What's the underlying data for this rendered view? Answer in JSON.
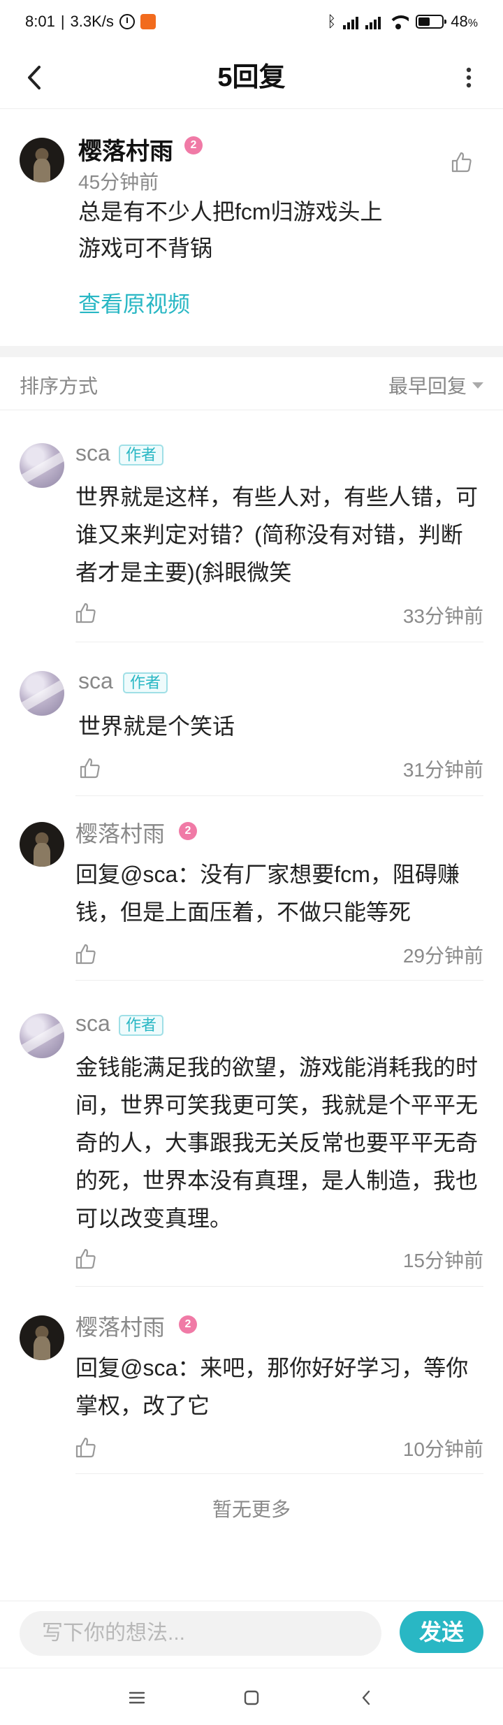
{
  "status_bar": {
    "time": "8:01",
    "speed": "3.3K/s",
    "battery": "48"
  },
  "header": {
    "title": "5回复",
    "back_icon": "chevron-left-icon",
    "more_icon": "more-vertical-icon"
  },
  "original_comment": {
    "username": "樱落村雨",
    "level": "2",
    "time": "45分钟前",
    "text_line1": "总是有不少人把fcm归游戏头上",
    "text_line2": "游戏可不背锅",
    "view_link": "查看原视频"
  },
  "sort": {
    "label": "排序方式",
    "selected": "最早回复"
  },
  "replies": [
    {
      "username": "sca",
      "badge": "作者",
      "text": "世界就是这样，有些人对，有些人错，可谁又来判定对错？(简称没有对错，判断者才是主要)(斜眼微笑",
      "time": "33分钟前"
    },
    {
      "username": "sca",
      "badge": "作者",
      "text": "世界就是个笑话",
      "time": "31分钟前"
    },
    {
      "username": "樱落村雨",
      "level": "2",
      "reply_prefix": "回复@sca：",
      "text": "没有厂家想要fcm，阻碍赚钱，但是上面压着，不做只能等死",
      "time": "29分钟前"
    },
    {
      "username": "sca",
      "badge": "作者",
      "text": "金钱能满足我的欲望，游戏能消耗我的时间，世界可笑我更可笑，我就是个平平无奇的人，大事跟我无关反常也要平平无奇的死，世界本没有真理，是人制造，我也可以改变真理。",
      "time": "15分钟前"
    },
    {
      "username": "樱落村雨",
      "level": "2",
      "reply_prefix": "回复@sca：",
      "text": "来吧，那你好好学习，等你掌权，改了它",
      "time": "10分钟前"
    }
  ],
  "footer_note": "暂无更多",
  "input": {
    "placeholder": "写下你的想法...",
    "send_label": "发送"
  },
  "colors": {
    "accent": "#29b7c4",
    "level_badge": "#f07aa6"
  }
}
